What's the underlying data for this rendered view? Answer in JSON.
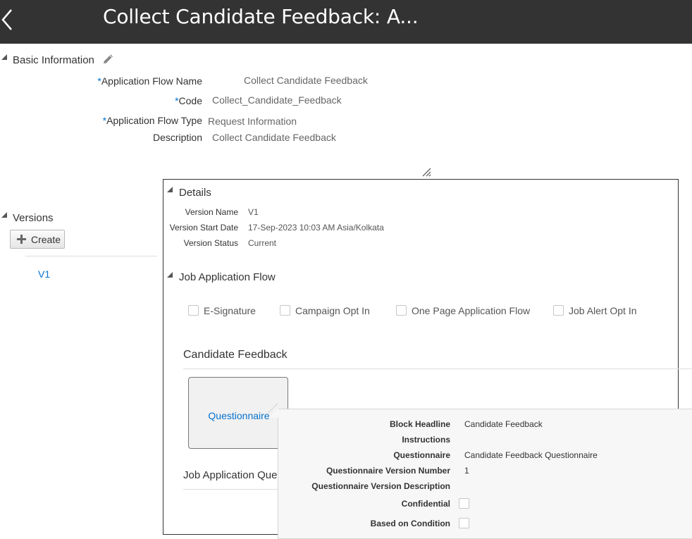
{
  "header": {
    "title": "Collect Candidate Feedback: A..."
  },
  "basic_information": {
    "title": "Basic Information",
    "fields": [
      {
        "label": "Application Flow Name",
        "value": "Collect Candidate Feedback",
        "required": true
      },
      {
        "label": "Code",
        "value": "Collect_Candidate_Feedback",
        "required": true
      },
      {
        "label": "Application Flow Type",
        "value": "Request Information",
        "required": true
      },
      {
        "label": "Description",
        "value": "Collect Candidate Feedback",
        "required": false
      }
    ],
    "required_marker": "*"
  },
  "versions": {
    "title": "Versions",
    "create_label": "Create",
    "items": [
      {
        "label": "V1"
      }
    ]
  },
  "details": {
    "title": "Details",
    "fields": [
      {
        "label": "Version Name",
        "value": "V1"
      },
      {
        "label": "Version Start Date",
        "value": "17-Sep-2023 10:03 AM Asia/Kolkata"
      },
      {
        "label": "Version Status",
        "value": "Current"
      }
    ]
  },
  "job_application_flow": {
    "title": "Job Application Flow",
    "options": [
      {
        "label": "E-Signature",
        "checked": false
      },
      {
        "label": "Campaign Opt In",
        "checked": false
      },
      {
        "label": "One Page Application Flow",
        "checked": false
      },
      {
        "label": "Job Alert Opt In",
        "checked": false
      }
    ]
  },
  "candidate_feedback": {
    "title": "Candidate Feedback",
    "block_label": "Questionnaire"
  },
  "job_application_questions": {
    "title": "Job Application Que"
  },
  "popup": {
    "fields": [
      {
        "label": "Block Headline",
        "value": "Candidate Feedback"
      },
      {
        "label": "Instructions",
        "value": ""
      },
      {
        "label": "Questionnaire",
        "value": "Candidate Feedback Questionnaire"
      },
      {
        "label": "Questionnaire Version Number",
        "value": "1"
      },
      {
        "label": "Questionnaire Version Description",
        "value": ""
      }
    ],
    "checkboxes": [
      {
        "label": "Confidential",
        "checked": false
      },
      {
        "label": "Based on Condition",
        "checked": false
      }
    ]
  }
}
